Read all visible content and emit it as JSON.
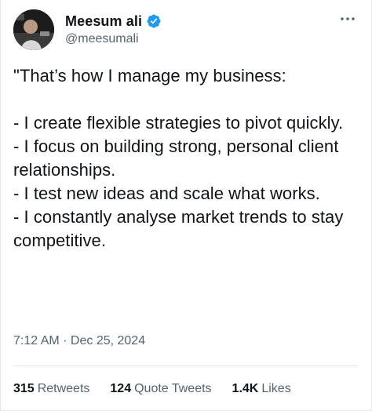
{
  "author": {
    "display_name": "Meesum ali",
    "handle": "@meesumali",
    "verified_icon": "verified-badge-icon"
  },
  "tweet": {
    "text": "\"That’s how I manage my business:\n\n- I create flexible strategies to pivot quickly.\n- I focus on building strong, personal client relationships.\n- I test new ideas and scale what works.\n- I constantly analyse market trends to stay competitive.",
    "timestamp": "7:12 AM · Dec 25, 2024"
  },
  "stats": {
    "retweets_count": "315",
    "retweets_label": "Retweets",
    "quotes_count": "124",
    "quotes_label": "Quote Tweets",
    "likes_count": "1.4K",
    "likes_label": "Likes"
  },
  "colors": {
    "verified": "#1d9bf0",
    "primary_text": "#0f1419",
    "secondary_text": "#536471"
  }
}
